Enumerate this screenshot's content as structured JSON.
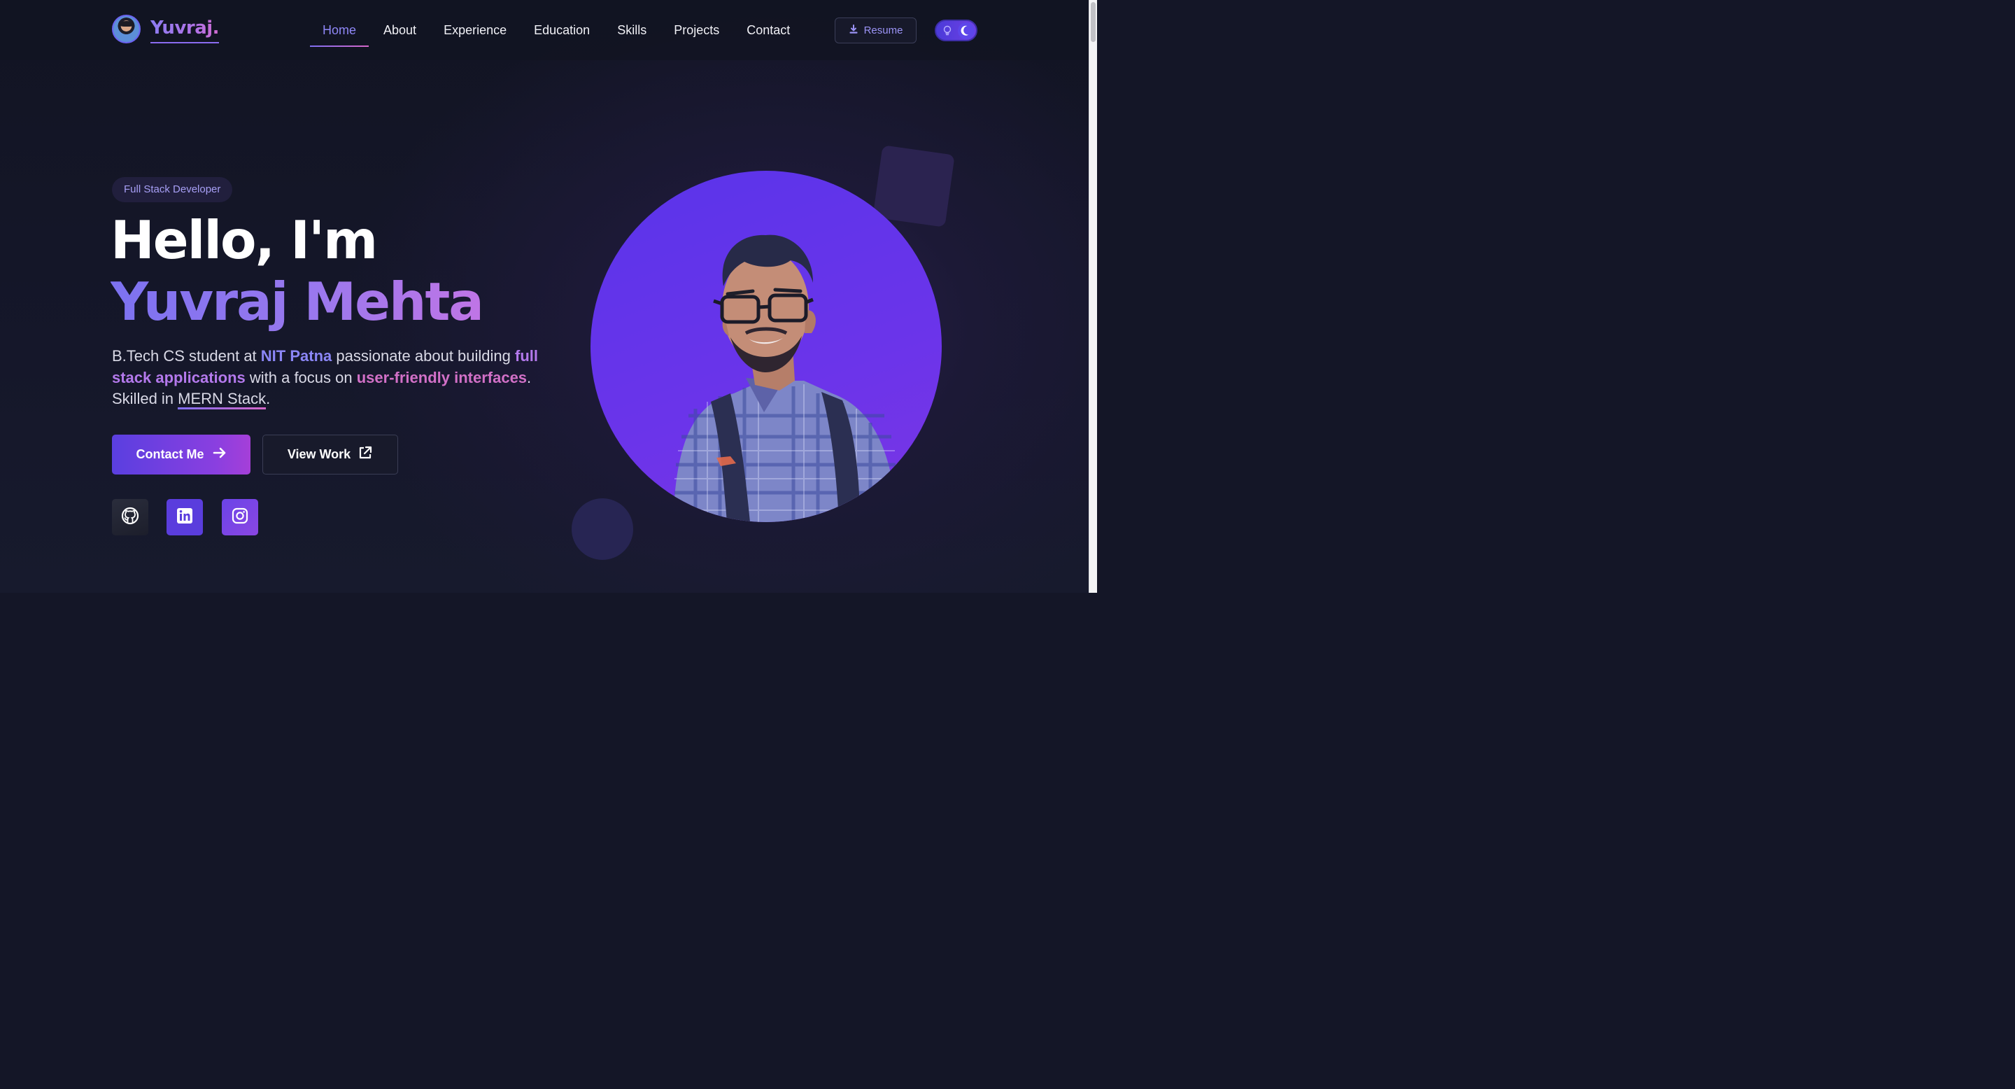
{
  "header": {
    "brand_name": "Yuvraj.",
    "nav": [
      {
        "label": "Home",
        "active": true
      },
      {
        "label": "About",
        "active": false
      },
      {
        "label": "Experience",
        "active": false
      },
      {
        "label": "Education",
        "active": false
      },
      {
        "label": "Skills",
        "active": false
      },
      {
        "label": "Projects",
        "active": false
      },
      {
        "label": "Contact",
        "active": false
      }
    ],
    "resume_label": "Resume",
    "resume_icon": "download-icon",
    "theme_toggle": {
      "mode": "dark",
      "icons": [
        "lightbulb-icon",
        "moon-icon"
      ]
    }
  },
  "hero": {
    "badge": "Full Stack Developer",
    "greeting": "Hello, I'm",
    "name": "Yuvraj Mehta",
    "bio": {
      "t1": "B.Tech CS student at ",
      "h1": "NIT Patna",
      "t2": " passionate about building ",
      "h2": "full stack applications",
      "t3": " with a focus on ",
      "h3": "user-friendly interfaces",
      "t4": ". Skilled in ",
      "h4": "MERN Stack",
      "t5": "."
    },
    "primary_button": {
      "label": "Contact Me",
      "icon": "arrow-right-icon"
    },
    "secondary_button": {
      "label": "View Work",
      "icon": "external-link-icon"
    },
    "socials": [
      {
        "name": "GitHub",
        "icon": "github-icon"
      },
      {
        "name": "LinkedIn",
        "icon": "linkedin-icon"
      },
      {
        "name": "Instagram",
        "icon": "instagram-icon"
      }
    ]
  },
  "colors": {
    "background": "#141627",
    "accent": "#7c72f0",
    "accent_pink": "#d270c7",
    "portrait_bg": "#5a34ea"
  }
}
